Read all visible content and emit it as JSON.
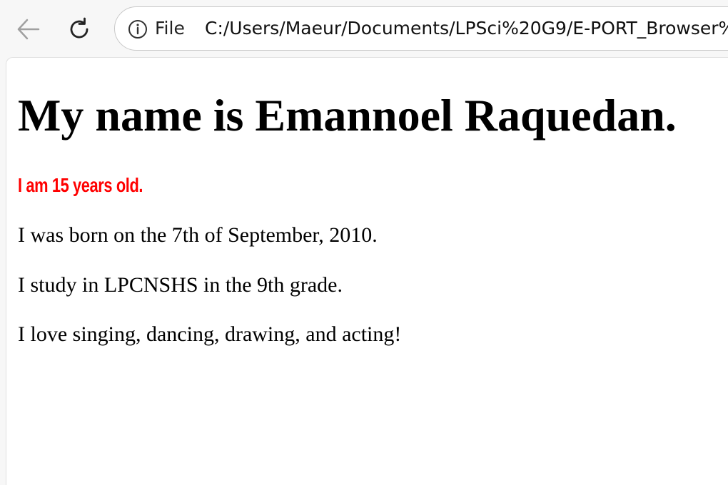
{
  "browser": {
    "back_icon": "back-arrow-icon",
    "reload_icon": "reload-icon",
    "info_icon": "info-icon",
    "scheme_label": "File",
    "url": "C:/Users/Maeur/Documents/LPSci%20G9/E-PORT_Browser%"
  },
  "page": {
    "heading": "My name is Emannoel Raquedan.",
    "age_text": "I am 15 years old.",
    "age_color": "#ff0000",
    "paragraphs": [
      "I was born on the 7th of September, 2010.",
      "I study in LPCNSHS in the 9th grade.",
      "I love singing, dancing, drawing, and acting!"
    ]
  }
}
